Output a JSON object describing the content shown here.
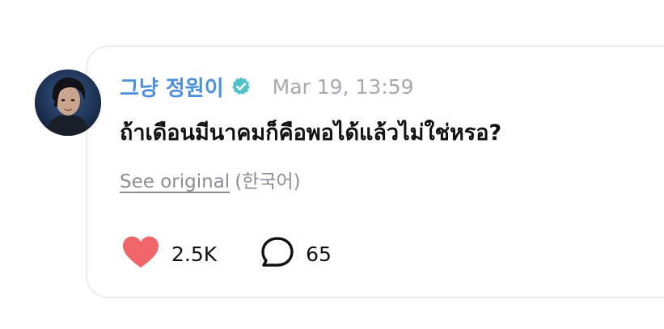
{
  "post": {
    "author_name": "그냥 정원이",
    "verified_icon": "verified-badge-icon",
    "timestamp": "Mar 19, 13:59",
    "message": "ถ้าเดือนมีนาคมก็คือพอได้แล้วไม่ใช่หรอ?",
    "see_original_label": "See original",
    "original_language": "(한국어)"
  },
  "actions": {
    "like_icon": "heart-icon",
    "like_count": "2.5K",
    "comment_icon": "speech-bubble-icon",
    "comment_count": "65"
  },
  "colors": {
    "author": "#4a8fe0",
    "verified": "#4fc3c8",
    "timestamp": "#a6a9b2",
    "heart": "#f0656a",
    "muted": "#8b8e96",
    "card_border": "#ececef"
  }
}
